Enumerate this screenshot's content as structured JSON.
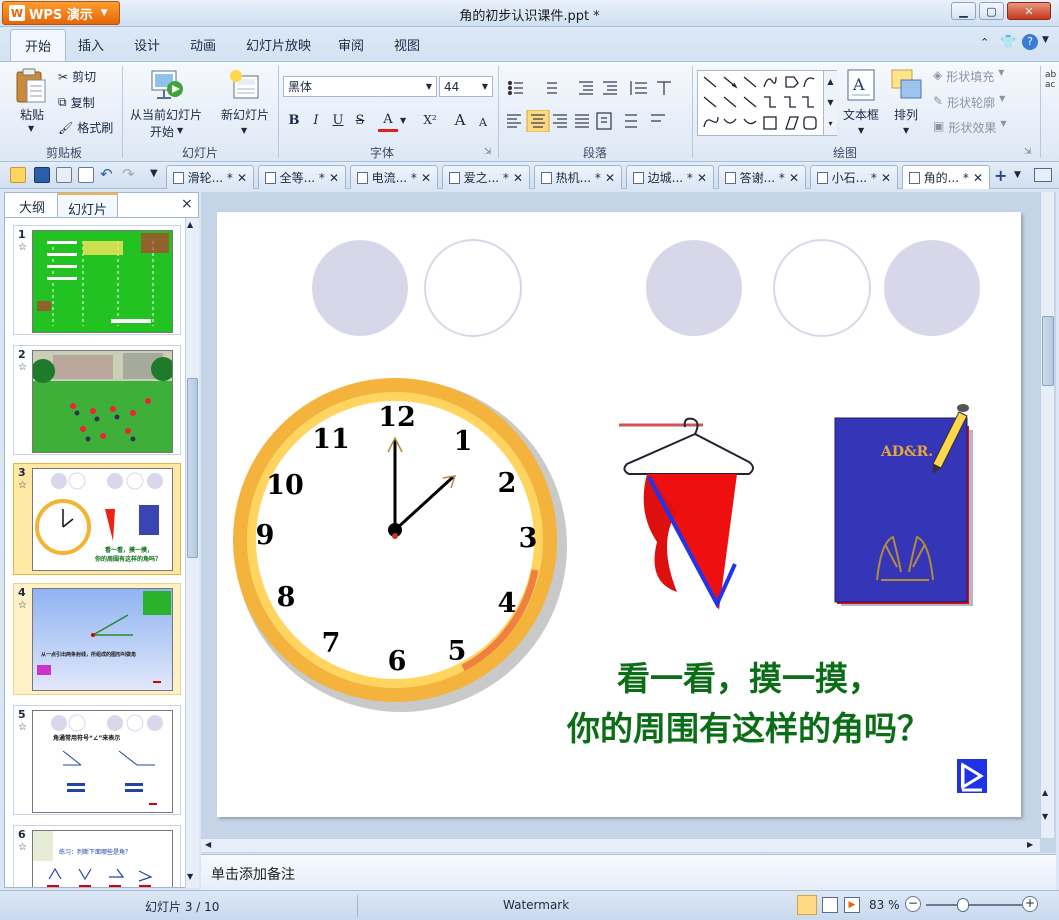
{
  "app": {
    "name": "WPS 演示",
    "logo_letter": "W",
    "window_title": "角的初步认识课件.ppt *"
  },
  "menu": {
    "items": [
      "开始",
      "插入",
      "设计",
      "动画",
      "幻灯片放映",
      "审阅",
      "视图"
    ],
    "active": "开始"
  },
  "ribbon": {
    "clipboard": {
      "paste": "粘贴",
      "cut": "剪切",
      "copy": "复制",
      "format_painter": "格式刷",
      "group_label": "剪贴板"
    },
    "slides": {
      "from_current_line1": "从当前幻灯片",
      "from_current_line2": "开始",
      "new_slide": "新幻灯片",
      "group_label": "幻灯片"
    },
    "font": {
      "name": "黑体",
      "size": "44",
      "bold": "B",
      "italic": "I",
      "underline": "U",
      "strike": "S",
      "color": "A",
      "superscript": "X²",
      "grow": "A",
      "shrink": "A",
      "group_label": "字体"
    },
    "paragraph": {
      "group_label": "段落"
    },
    "drawing": {
      "textbox": "文本框",
      "arrange": "排列",
      "shape_fill": "形状填充",
      "shape_outline": "形状轮廓",
      "shape_effect": "形状效果",
      "group_label": "绘图"
    }
  },
  "tabs": [
    {
      "label": "滑轮... *"
    },
    {
      "label": "全等... *"
    },
    {
      "label": "电流... *"
    },
    {
      "label": "爱之... *"
    },
    {
      "label": "热机... *"
    },
    {
      "label": "边城... *"
    },
    {
      "label": "答谢... *"
    },
    {
      "label": "小石... *"
    },
    {
      "label": "角的... *"
    }
  ],
  "panel": {
    "tab_outline": "大纲",
    "tab_slides": "幻灯片",
    "close": "×"
  },
  "thumbnails": [
    {
      "num": "1",
      "mark": "☆"
    },
    {
      "num": "2",
      "mark": "☆"
    },
    {
      "num": "3",
      "mark": "☆"
    },
    {
      "num": "4",
      "mark": "☆"
    },
    {
      "num": "5",
      "mark": "☆"
    },
    {
      "num": "6",
      "mark": "☆"
    }
  ],
  "thumb_text": {
    "t3_line1": "看一看，摸一摸，",
    "t3_line2": "你的周围有这样的角吗？",
    "t5_title": "角通常用符号“∠”来表示",
    "t6_title": "练习：判断下面哪些是角？",
    "t4_caption": "从一点引出两条射线，所组成的图形叫做角"
  },
  "slide": {
    "line1": "看一看，摸一摸，",
    "line2": "你的周围有这样的角吗？",
    "book_label": "AD&R.",
    "clock_numbers": [
      "12",
      "1",
      "2",
      "3",
      "4",
      "5",
      "6",
      "7",
      "8",
      "9",
      "10",
      "11"
    ]
  },
  "notes": {
    "placeholder": "单击添加备注"
  },
  "status": {
    "slide_counter": "幻灯片 3 / 10",
    "watermark": "Watermark",
    "zoom": "83 %"
  },
  "colors": {
    "accent_orange": "#e3660a",
    "slide_text_green": "#0b6e17",
    "selected_thumb": "#ffe8a3"
  }
}
